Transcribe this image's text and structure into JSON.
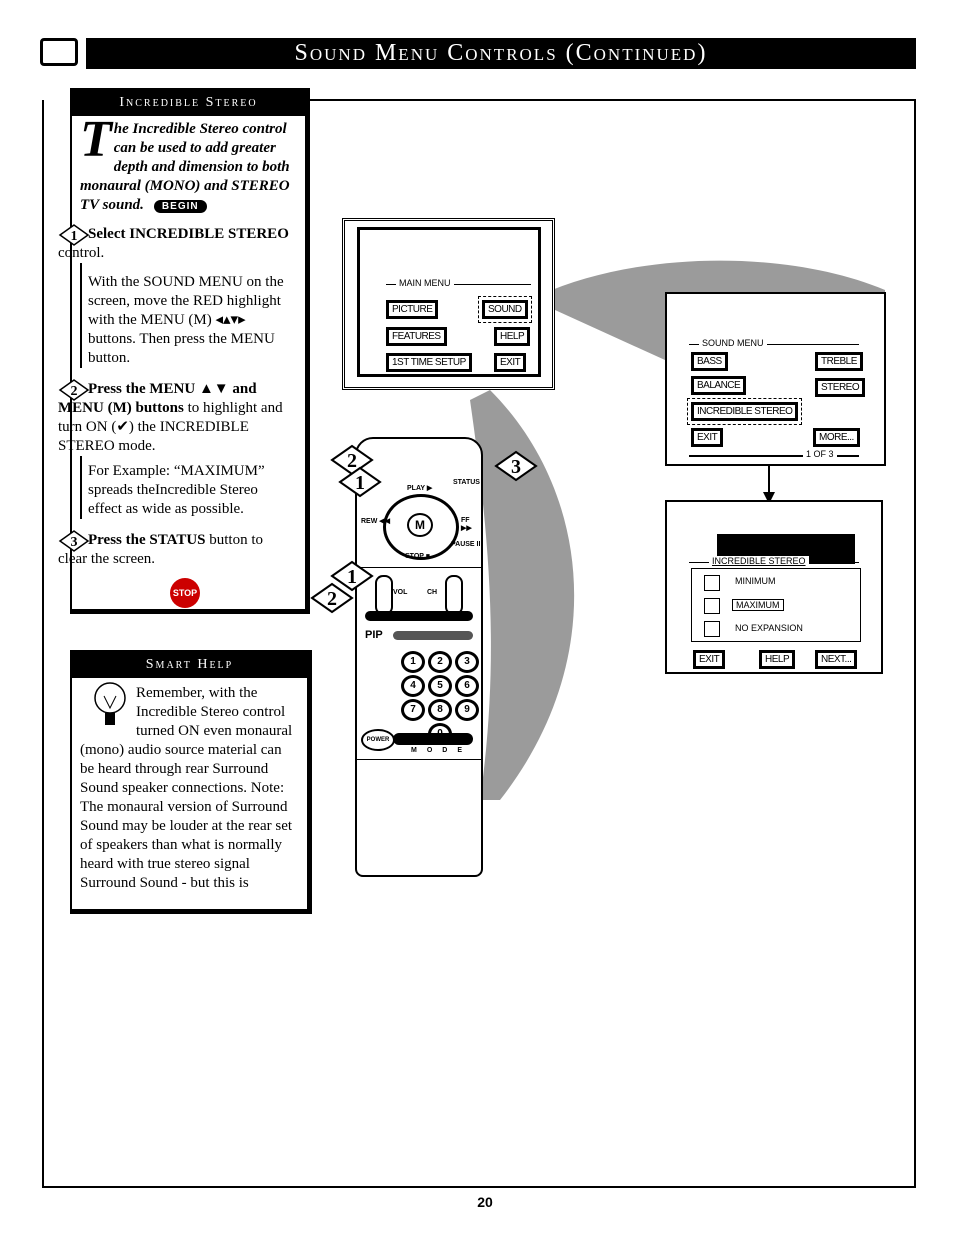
{
  "header": {
    "title": "Sound Menu Controls (Continued)"
  },
  "incredible_stereo": {
    "heading": "Incredible Stereo",
    "intro_dropcap": "T",
    "intro": "he Incredible Stereo control can be used to add greater depth and dimension to both monaural (MONO) and STEREO TV sound.",
    "begin_badge": "BEGIN",
    "steps": [
      {
        "num": "1",
        "title_bold": "Select INCREDIBLE STEREO",
        "title_rest": " control.",
        "body": "With the SOUND MENU on the screen, move the RED highlight with the MENU (M) ◂▴▾▸ buttons. Then press the MENU button."
      },
      {
        "num": "2",
        "title_bold": "Press the MENU ▲▼ and MENU (M) buttons",
        "title_rest": " to highlight and turn ON (✔) the INCREDIBLE STEREO mode.",
        "body": "For Example: “MAXIMUM” spreads theIncredible Stereo effect as wide as possible."
      },
      {
        "num": "3",
        "title_bold": "Press the STATUS",
        "title_rest": " button to clear the screen.",
        "body": ""
      }
    ],
    "stop_badge": "STOP"
  },
  "smart_help": {
    "heading": "Smart Help",
    "body": "Remember, with the Incredible Stereo control turned ON even monaural (mono) audio source material can be heard through rear Surround Sound speaker connections. Note: The monaural version of Surround Sound may be louder at the rear set of speakers than what is normally heard with true stereo signal Surround Sound - but this is"
  },
  "main_menu": {
    "label": "MAIN MENU",
    "items": [
      "PICTURE",
      "SOUND",
      "FEATURES",
      "HELP",
      "1ST TIME SETUP",
      "EXIT"
    ],
    "highlighted": "SOUND"
  },
  "sound_menu": {
    "label": "SOUND MENU",
    "items": [
      "BASS",
      "TREBLE",
      "BALANCE",
      "STEREO",
      "INCREDIBLE STEREO",
      "EXIT",
      "MORE..."
    ],
    "highlighted": "INCREDIBLE STEREO",
    "page": "1 OF 3"
  },
  "incredible_menu": {
    "label": "INCREDIBLE STEREO",
    "options": [
      "MINIMUM",
      "MAXIMUM",
      "NO EXPANSION"
    ],
    "highlighted": "MAXIMUM",
    "buttons": [
      "EXIT",
      "HELP",
      "NEXT..."
    ]
  },
  "remote": {
    "labels": [
      "PLAY ▶",
      "STATUS",
      "REW ◀◀",
      "FF ▶▶",
      "PAUSE II",
      "STOP ■",
      "VOL",
      "CH",
      "PIP",
      "POWER",
      "M",
      "O",
      "D",
      "E"
    ],
    "keys": [
      "1",
      "2",
      "3",
      "4",
      "5",
      "6",
      "7",
      "8",
      "9",
      "0"
    ],
    "callouts": [
      "2",
      "1",
      "3",
      "1",
      "2"
    ]
  },
  "page_number": "20"
}
